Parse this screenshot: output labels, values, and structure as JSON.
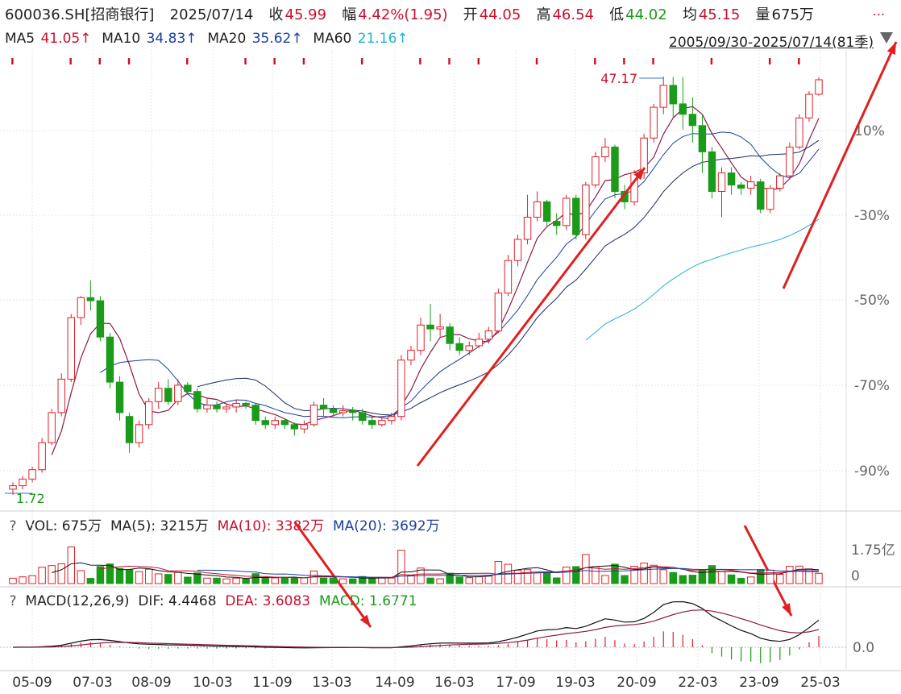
{
  "header": {
    "code": "600036.SH[招商银行]",
    "date": "2025/07/14",
    "close_label": "收",
    "close": "45.99",
    "amp_label": "幅",
    "amp": "4.42%(1.95)",
    "open_label": "开",
    "open": "44.05",
    "high_label": "高",
    "high": "46.54",
    "low_label": "低",
    "low": "44.02",
    "avg_label": "均",
    "avg": "45.15",
    "vol_label": "量",
    "vol": "675万",
    "more": "..."
  },
  "ma_line": {
    "ma5_label": "MA5",
    "ma5": "41.05↑",
    "ma10_label": "MA10",
    "ma10": "34.83↑",
    "ma20_label": "MA20",
    "ma20": "35.62↑",
    "ma60_label": "MA60",
    "ma60": "21.16↑",
    "range": "2005/09/30-2025/07/14(81季)"
  },
  "vol_panel": {
    "q": "?",
    "vol": "VOL: 675万",
    "ma5": "MA(5): 3215万",
    "ma10": "MA(10): 3382万",
    "ma20": "MA(20): 3692万"
  },
  "macd_panel": {
    "q": "?",
    "name": "MACD(12,26,9)",
    "dif": "DIF: 4.4468",
    "dea": "DEA: 3.6083",
    "macd": "MACD: 1.6771"
  },
  "chart_data": {
    "type": "candlestick",
    "period": "quarterly",
    "x_tick_labels": [
      "05-09",
      "07-03",
      "08-09",
      "10-03",
      "11-09",
      "13-03",
      "14-09",
      "16-03",
      "17-09",
      "19-03",
      "20-09",
      "22-03",
      "23-09",
      "25-03"
    ],
    "price_axis": {
      "scale": "log",
      "tick_labels": [
        "10%",
        "-30%",
        "-50%",
        "-70%",
        "-90%"
      ]
    },
    "annotations": {
      "max_label": "47.17",
      "min_label": "1.72"
    },
    "volume_axis_labels": [
      "1.75亿",
      "0"
    ],
    "macd_axis_labels": [
      "0.0"
    ],
    "candles": [
      {
        "o": 1.8,
        "c": 1.85,
        "h": 1.9,
        "l": 1.72
      },
      {
        "o": 1.85,
        "c": 1.95,
        "h": 2.0,
        "l": 1.8
      },
      {
        "o": 1.95,
        "c": 2.1,
        "h": 2.15,
        "l": 1.9
      },
      {
        "o": 2.1,
        "c": 2.6,
        "h": 2.7,
        "l": 2.05
      },
      {
        "o": 2.6,
        "c": 3.3,
        "h": 3.4,
        "l": 2.55
      },
      {
        "o": 3.3,
        "c": 4.3,
        "h": 4.5,
        "l": 3.2
      },
      {
        "o": 4.3,
        "c": 7.0,
        "h": 7.2,
        "l": 4.2
      },
      {
        "o": 7.0,
        "c": 8.2,
        "h": 8.3,
        "l": 6.6
      },
      {
        "o": 8.2,
        "c": 8.0,
        "h": 9.4,
        "l": 7.4
      },
      {
        "o": 8.0,
        "c": 6.0,
        "h": 8.3,
        "l": 5.8
      },
      {
        "o": 6.0,
        "c": 4.2,
        "h": 6.2,
        "l": 4.0
      },
      {
        "o": 4.2,
        "c": 3.3,
        "h": 4.4,
        "l": 3.1
      },
      {
        "o": 3.2,
        "c": 2.6,
        "h": 3.3,
        "l": 2.4
      },
      {
        "o": 2.6,
        "c": 3.0,
        "h": 3.1,
        "l": 2.5
      },
      {
        "o": 3.0,
        "c": 3.6,
        "h": 3.7,
        "l": 2.9
      },
      {
        "o": 3.6,
        "c": 4.0,
        "h": 4.2,
        "l": 3.4
      },
      {
        "o": 4.0,
        "c": 3.6,
        "h": 4.3,
        "l": 3.5
      },
      {
        "o": 3.6,
        "c": 4.1,
        "h": 4.3,
        "l": 3.5
      },
      {
        "o": 4.1,
        "c": 3.9,
        "h": 4.2,
        "l": 3.8
      },
      {
        "o": 3.9,
        "c": 3.4,
        "h": 4.0,
        "l": 3.3
      },
      {
        "o": 3.4,
        "c": 3.5,
        "h": 3.7,
        "l": 3.3
      },
      {
        "o": 3.5,
        "c": 3.4,
        "h": 3.6,
        "l": 3.3
      },
      {
        "o": 3.4,
        "c": 3.45,
        "h": 3.55,
        "l": 3.3
      },
      {
        "o": 3.45,
        "c": 3.55,
        "h": 3.65,
        "l": 3.3
      },
      {
        "o": 3.55,
        "c": 3.5,
        "h": 3.6,
        "l": 3.4
      },
      {
        "o": 3.5,
        "c": 3.1,
        "h": 3.55,
        "l": 3.0
      },
      {
        "o": 3.1,
        "c": 3.0,
        "h": 3.2,
        "l": 2.9
      },
      {
        "o": 3.0,
        "c": 3.1,
        "h": 3.2,
        "l": 2.9
      },
      {
        "o": 3.1,
        "c": 3.0,
        "h": 3.15,
        "l": 2.9
      },
      {
        "o": 3.0,
        "c": 2.9,
        "h": 3.05,
        "l": 2.75
      },
      {
        "o": 2.9,
        "c": 3.0,
        "h": 3.1,
        "l": 2.8
      },
      {
        "o": 3.0,
        "c": 3.5,
        "h": 3.6,
        "l": 2.95
      },
      {
        "o": 3.5,
        "c": 3.4,
        "h": 3.7,
        "l": 3.2
      },
      {
        "o": 3.4,
        "c": 3.3,
        "h": 3.5,
        "l": 3.2
      },
      {
        "o": 3.3,
        "c": 3.35,
        "h": 3.5,
        "l": 3.2
      },
      {
        "o": 3.35,
        "c": 3.3,
        "h": 3.45,
        "l": 3.1
      },
      {
        "o": 3.3,
        "c": 3.1,
        "h": 3.4,
        "l": 3.0
      },
      {
        "o": 3.1,
        "c": 3.0,
        "h": 3.2,
        "l": 2.9
      },
      {
        "o": 3.0,
        "c": 3.1,
        "h": 3.2,
        "l": 2.95
      },
      {
        "o": 3.1,
        "c": 3.2,
        "h": 3.3,
        "l": 3.0
      },
      {
        "o": 3.2,
        "c": 5.0,
        "h": 5.2,
        "l": 3.1
      },
      {
        "o": 5.0,
        "c": 5.4,
        "h": 5.6,
        "l": 4.8
      },
      {
        "o": 5.4,
        "c": 6.6,
        "h": 7.0,
        "l": 5.2
      },
      {
        "o": 6.6,
        "c": 6.4,
        "h": 7.8,
        "l": 5.8
      },
      {
        "o": 6.4,
        "c": 6.5,
        "h": 7.2,
        "l": 6.0
      },
      {
        "o": 6.5,
        "c": 5.7,
        "h": 6.7,
        "l": 5.4
      },
      {
        "o": 5.7,
        "c": 5.4,
        "h": 6.0,
        "l": 5.2
      },
      {
        "o": 5.4,
        "c": 5.6,
        "h": 5.8,
        "l": 5.2
      },
      {
        "o": 5.6,
        "c": 5.9,
        "h": 6.2,
        "l": 5.5
      },
      {
        "o": 5.9,
        "c": 6.3,
        "h": 6.5,
        "l": 5.7
      },
      {
        "o": 6.3,
        "c": 8.5,
        "h": 8.8,
        "l": 6.2
      },
      {
        "o": 8.5,
        "c": 11.0,
        "h": 11.5,
        "l": 8.3
      },
      {
        "o": 11.0,
        "c": 13.0,
        "h": 13.5,
        "l": 10.5
      },
      {
        "o": 13.0,
        "c": 15.5,
        "h": 18.5,
        "l": 12.5
      },
      {
        "o": 15.5,
        "c": 17.5,
        "h": 19.0,
        "l": 15.0
      },
      {
        "o": 17.5,
        "c": 15.0,
        "h": 17.8,
        "l": 14.5
      },
      {
        "o": 15.0,
        "c": 14.5,
        "h": 16.0,
        "l": 13.5
      },
      {
        "o": 14.5,
        "c": 18.0,
        "h": 18.5,
        "l": 14.0
      },
      {
        "o": 18.0,
        "c": 13.5,
        "h": 18.5,
        "l": 13.0
      },
      {
        "o": 13.5,
        "c": 20.0,
        "h": 20.5,
        "l": 13.0
      },
      {
        "o": 20.0,
        "c": 25.0,
        "h": 26.0,
        "l": 19.5
      },
      {
        "o": 25.0,
        "c": 27.0,
        "h": 29.0,
        "l": 24.0
      },
      {
        "o": 27.0,
        "c": 19.0,
        "h": 27.5,
        "l": 18.0
      },
      {
        "o": 19.0,
        "c": 17.5,
        "h": 20.0,
        "l": 16.5
      },
      {
        "o": 17.5,
        "c": 22.0,
        "h": 22.5,
        "l": 17.0
      },
      {
        "o": 22.0,
        "c": 29.0,
        "h": 30.0,
        "l": 21.0
      },
      {
        "o": 29.0,
        "c": 37.0,
        "h": 38.0,
        "l": 28.0
      },
      {
        "o": 37.0,
        "c": 44.0,
        "h": 47.17,
        "l": 35.0
      },
      {
        "o": 44.0,
        "c": 38.0,
        "h": 47.0,
        "l": 34.0
      },
      {
        "o": 38.0,
        "c": 35.0,
        "h": 47.0,
        "l": 31.0
      },
      {
        "o": 35.0,
        "c": 32.0,
        "h": 40.0,
        "l": 28.0
      },
      {
        "o": 32.0,
        "c": 26.0,
        "h": 35.0,
        "l": 22.0
      },
      {
        "o": 26.0,
        "c": 19.0,
        "h": 27.0,
        "l": 18.0
      },
      {
        "o": 19.0,
        "c": 22.0,
        "h": 23.0,
        "l": 15.5
      },
      {
        "o": 22.0,
        "c": 20.0,
        "h": 23.0,
        "l": 18.5
      },
      {
        "o": 20.0,
        "c": 19.5,
        "h": 20.5,
        "l": 18.5
      },
      {
        "o": 19.5,
        "c": 20.5,
        "h": 21.5,
        "l": 18.5
      },
      {
        "o": 20.5,
        "c": 16.5,
        "h": 21.0,
        "l": 16.0
      },
      {
        "o": 16.5,
        "c": 19.5,
        "h": 20.0,
        "l": 16.0
      },
      {
        "o": 19.5,
        "c": 21.5,
        "h": 22.0,
        "l": 19.0
      },
      {
        "o": 21.5,
        "c": 27.0,
        "h": 28.0,
        "l": 21.0
      },
      {
        "o": 27.0,
        "c": 34.0,
        "h": 35.0,
        "l": 26.5
      },
      {
        "o": 34.0,
        "c": 41.0,
        "h": 42.0,
        "l": 33.0
      },
      {
        "o": 41.0,
        "c": 45.99,
        "h": 47.0,
        "l": 40.5
      }
    ],
    "volume_ma_labels": [
      "MA(5)",
      "MA(10)",
      "MA(20)"
    ],
    "colors": {
      "up": "#e0202a",
      "down": "#1a9b1a",
      "ma5": "#8b1a4a",
      "ma10": "#1a3fa0",
      "ma20": "#1a2a6a",
      "ma60": "#1fb4d0",
      "arrow": "#e02020"
    }
  }
}
